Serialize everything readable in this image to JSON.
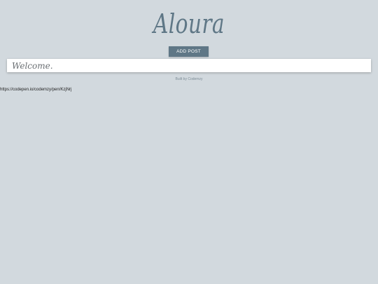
{
  "header": {
    "brand": "Aloura"
  },
  "toolbar": {
    "add_post_label": "ADD POST"
  },
  "post": {
    "value": "Welcome."
  },
  "footer": {
    "credit": "Built by Codemzy"
  },
  "status": {
    "url": "https://codepen.io/codemzy/pen/KzjNrj"
  },
  "colors": {
    "background": "#d2d9de",
    "accent": "#5f7786",
    "card": "#ffffff"
  }
}
